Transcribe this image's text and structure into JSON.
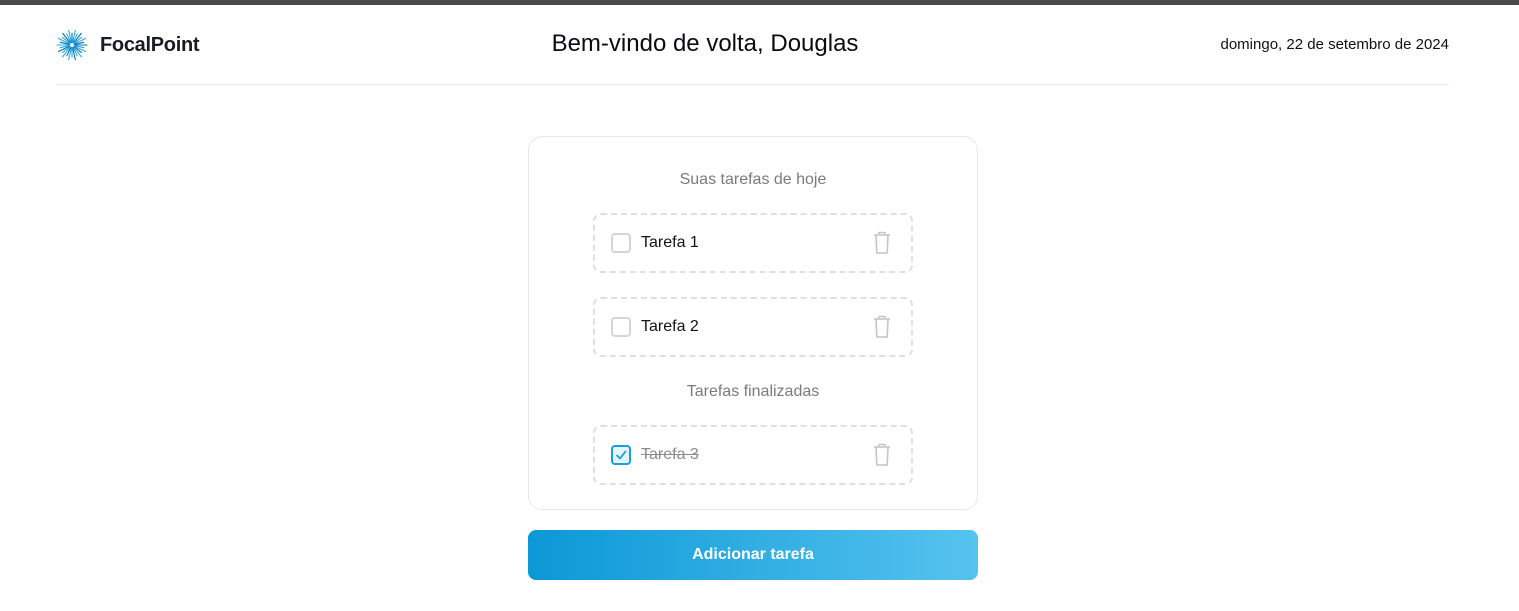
{
  "header": {
    "brand_name": "FocalPoint",
    "welcome": "Bem-vindo de volta, Douglas",
    "date": "domingo, 22 de setembro de 2024"
  },
  "tasks": {
    "today_title": "Suas tarefas de hoje",
    "today": [
      {
        "label": "Tarefa 1",
        "done": false
      },
      {
        "label": "Tarefa 2",
        "done": false
      }
    ],
    "finished_title": "Tarefas finalizadas",
    "finished": [
      {
        "label": "Tarefa 3",
        "done": true
      }
    ]
  },
  "add_button_label": "Adicionar tarefa",
  "colors": {
    "accent": "#1a9fd8",
    "button_gradient_start": "#0b98d6",
    "button_gradient_end": "#56c3ef",
    "top_bar": "#4a4a4f"
  },
  "icons": {
    "logo": "starburst-logo-icon",
    "delete": "trash-icon",
    "check": "check-icon"
  }
}
